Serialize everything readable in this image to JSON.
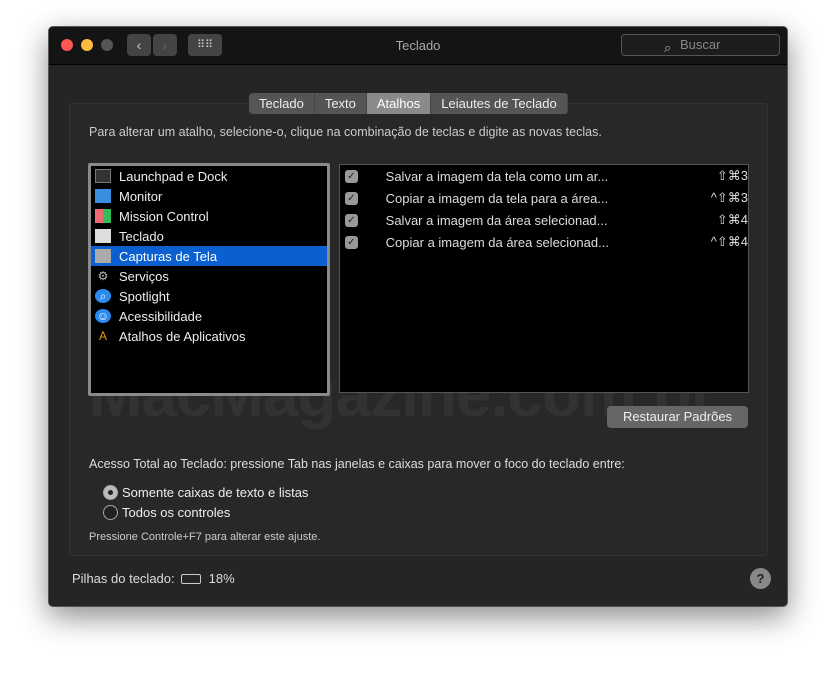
{
  "window": {
    "title": "Teclado",
    "search_placeholder": "Buscar"
  },
  "tabs": [
    "Teclado",
    "Texto",
    "Atalhos",
    "Leiautes de Teclado"
  ],
  "selected_tab": "Atalhos",
  "instruction": "Para alterar um atalho, selecione-o, clique na combinação de teclas e digite as novas teclas.",
  "categories": [
    {
      "label": "Launchpad e Dock",
      "icon": "launchpad-icon"
    },
    {
      "label": "Monitor",
      "icon": "monitor-icon"
    },
    {
      "label": "Mission Control",
      "icon": "mission-control-icon"
    },
    {
      "label": "Teclado",
      "icon": "keyboard-icon"
    },
    {
      "label": "Capturas de Tela",
      "icon": "screenshot-icon",
      "selected": true
    },
    {
      "label": "Serviços",
      "icon": "gear-icon"
    },
    {
      "label": "Spotlight",
      "icon": "spotlight-icon"
    },
    {
      "label": "Acessibilidade",
      "icon": "accessibility-icon"
    },
    {
      "label": "Atalhos de Aplicativos",
      "icon": "app-shortcuts-icon"
    }
  ],
  "shortcuts": [
    {
      "checked": true,
      "name": "Salvar a imagem da tela como um ar...",
      "keys": "⇧⌘3"
    },
    {
      "checked": true,
      "name": "Copiar a imagem da tela para a área...",
      "keys": "^⇧⌘3"
    },
    {
      "checked": true,
      "name": "Salvar a imagem da área selecionad...",
      "keys": "⇧⌘4"
    },
    {
      "checked": true,
      "name": "Copiar a imagem da área selecionad...",
      "keys": "^⇧⌘4"
    }
  ],
  "restore_button": "Restaurar Padrões",
  "watermark": "MacMagazine.com.br",
  "full_access_label": "Acesso Total ao Teclado: pressione Tab nas janelas e caixas para mover o foco do teclado entre:",
  "radio_options": [
    {
      "label": "Somente caixas de texto e listas",
      "selected": true
    },
    {
      "label": "Todos os controles",
      "selected": false
    }
  ],
  "hint": "Pressione Controle+F7 para alterar este ajuste.",
  "battery": {
    "label": "Pilhas do teclado:",
    "percent": "18%"
  },
  "help": "?"
}
